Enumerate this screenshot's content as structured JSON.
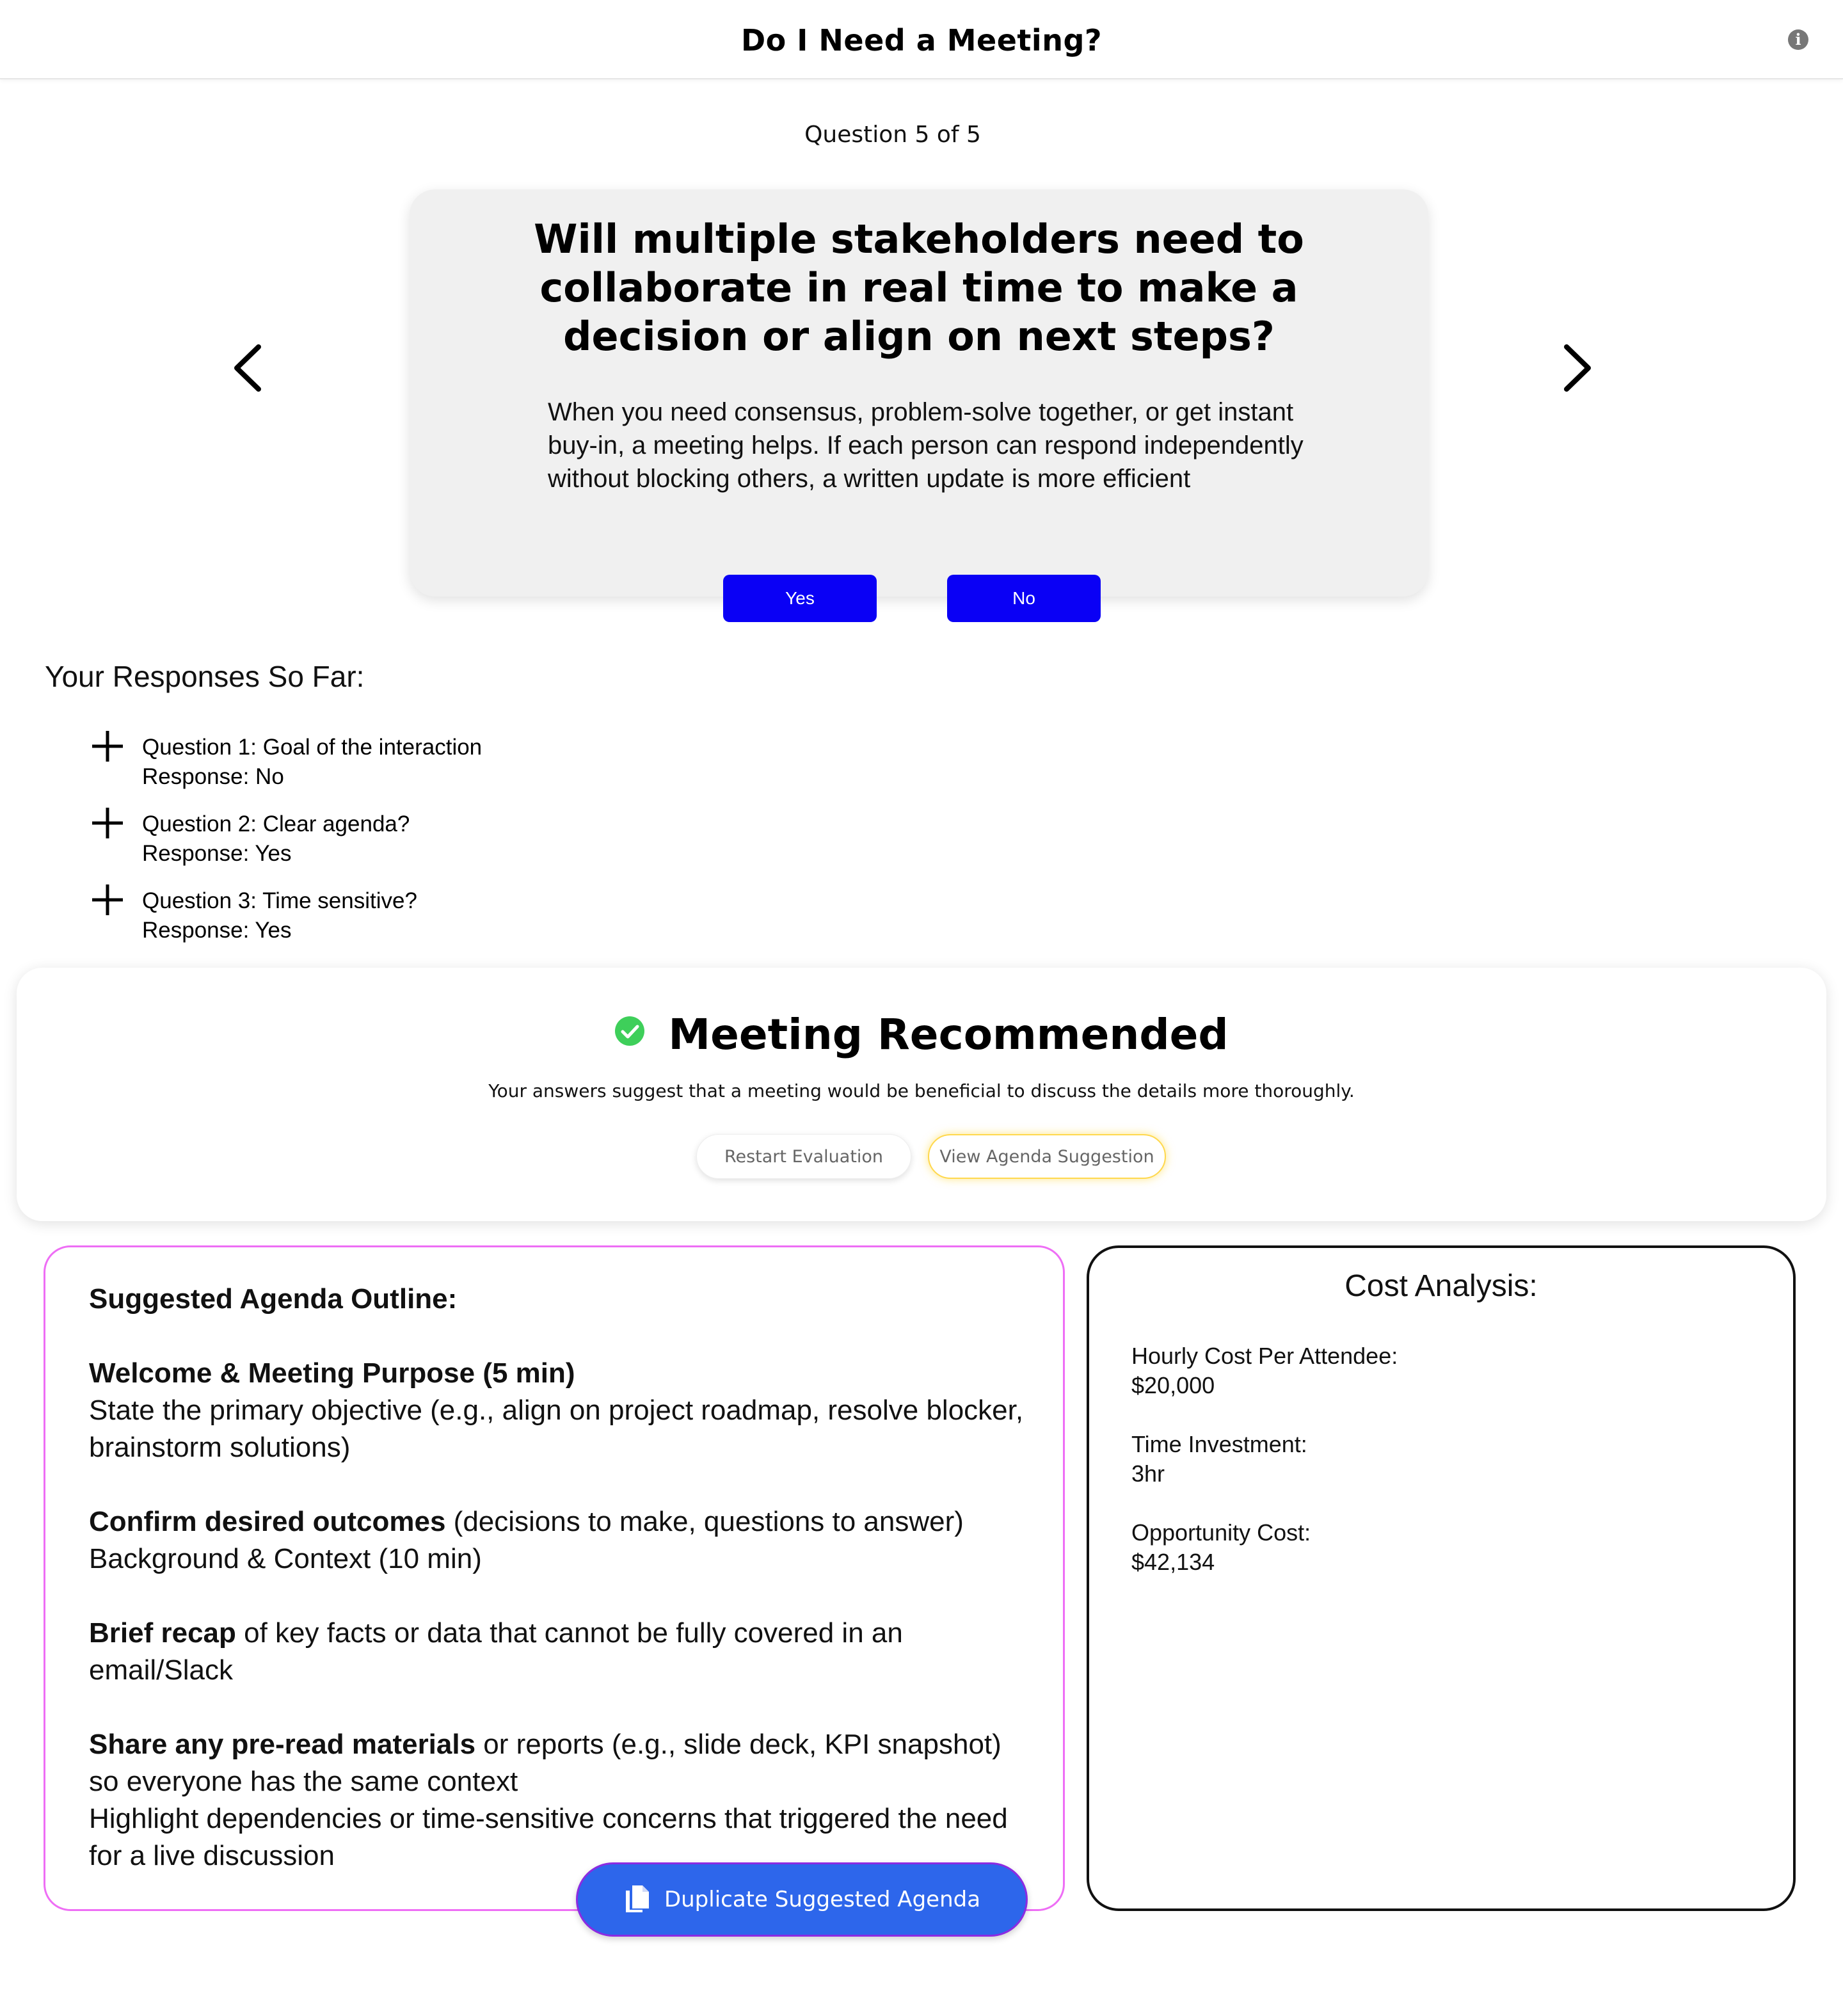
{
  "header": {
    "title": "Do I Need a Meeting?",
    "info_icon": "info-icon"
  },
  "progress": {
    "text": "Question 5 of 5",
    "current": 5,
    "total": 5
  },
  "question": {
    "title": "Will multiple stakeholders need to collaborate in real time to make a decision or align on next steps?",
    "description": "When you need consensus, problem-solve together, or get instant buy-in, a meeting helps. If each person can respond independently without blocking others, a written update is more efficient",
    "yes_label": "Yes",
    "no_label": "No",
    "prev_icon": "chevron-left-icon",
    "next_icon": "chevron-right-icon"
  },
  "responses": {
    "heading": "Your Responses So Far:",
    "items": [
      {
        "question": "Question 1: Goal of the interaction",
        "response": "Response: No"
      },
      {
        "question": "Question 2: Clear agenda?",
        "response": "Response: Yes"
      },
      {
        "question": "Question 3: Time sensitive?",
        "response": "Response: Yes"
      }
    ]
  },
  "result": {
    "title": "Meeting Recommended",
    "subtitle": "Your answers suggest that a meeting would be beneficial to discuss the details more thoroughly.",
    "restart_label": "Restart Evaluation",
    "view_agenda_label": "View Agenda Suggestion",
    "status_color": "#3ecf5a"
  },
  "agenda": {
    "heading": "Suggested Agenda Outline:",
    "block1_bold": "Welcome & Meeting Purpose (5 min)",
    "block1_text": "State the primary objective (e.g., align on project roadmap, resolve blocker, brainstorm solutions)",
    "block2_bold": "Confirm desired outcomes",
    "block2_text": " (decisions to make, questions to answer)",
    "block2_line2": "Background & Context (10 min)",
    "block3_bold": "Brief recap",
    "block3_text": " of key facts or data that cannot be fully covered in an email/Slack",
    "block4_bold": "Share any pre-read materials",
    "block4_text": " or reports (e.g., slide deck, KPI snapshot) so everyone has the same context",
    "block4_line2": "Highlight dependencies or time-sensitive concerns that triggered the need for a live discussion",
    "duplicate_label": "Duplicate Suggested Agenda"
  },
  "cost": {
    "title": "Cost Analysis:",
    "hourly_label": "Hourly Cost Per Attendee:",
    "hourly_value": "$20,000",
    "time_label": "Time Investment:",
    "time_value": "3hr",
    "opportunity_label": "Opportunity Cost:",
    "opportunity_value": "$42,134"
  },
  "colors": {
    "primary_button": "#0a00f5",
    "duplicate_button": "#2d66eb",
    "agenda_border": "#ee6ef5",
    "highlight_glow": "#ffd84d"
  }
}
